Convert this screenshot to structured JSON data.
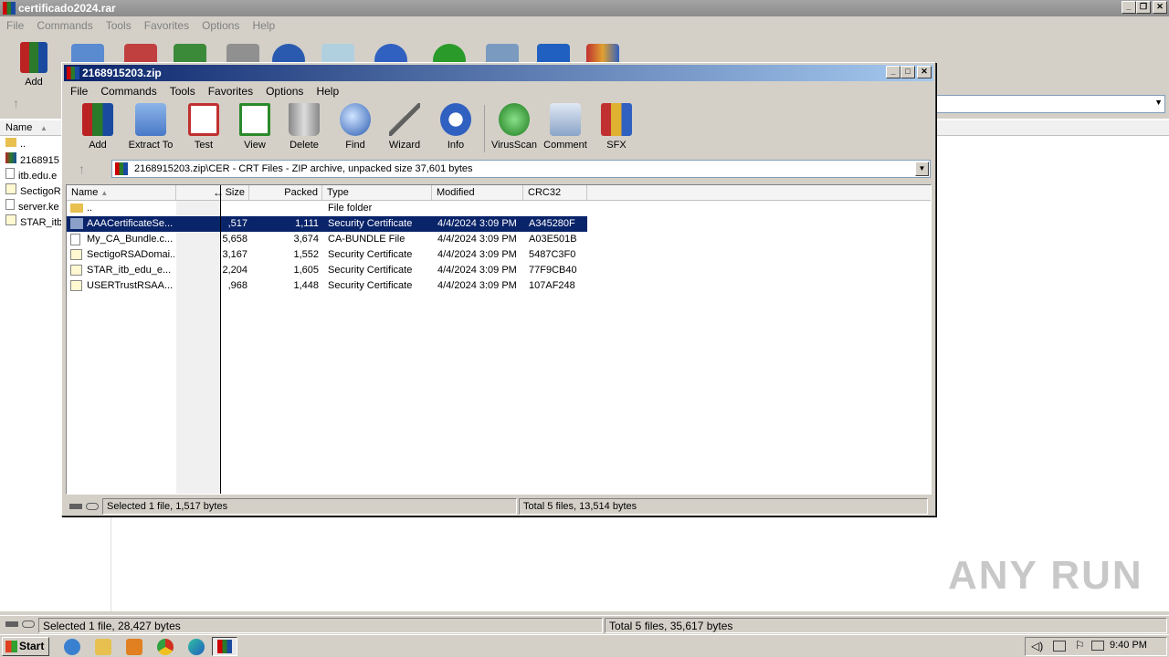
{
  "background_window": {
    "title": "certificado2024.rar",
    "menu": [
      "File",
      "Commands",
      "Tools",
      "Favorites",
      "Options",
      "Help"
    ],
    "toolbar_first_label": "Add",
    "column_name": "Name",
    "rows": [
      "..",
      "2168915",
      "itb.edu.e",
      "SectigoR",
      "server.ke",
      "STAR_itb"
    ],
    "status_left": "Selected 1 file, 28,427 bytes",
    "status_right": "Total 5 files, 35,617 bytes"
  },
  "front_window": {
    "title": "2168915203.zip",
    "menu": [
      "File",
      "Commands",
      "Tools",
      "Favorites",
      "Options",
      "Help"
    ],
    "toolbar": [
      "Add",
      "Extract To",
      "Test",
      "View",
      "Delete",
      "Find",
      "Wizard",
      "Info",
      "VirusScan",
      "Comment",
      "SFX"
    ],
    "path": "2168915203.zip\\CER - CRT Files - ZIP archive, unpacked size 37,601 bytes",
    "columns": [
      "Name",
      "Size",
      "Packed",
      "Type",
      "Modified",
      "CRC32"
    ],
    "rows": [
      {
        "name": "..",
        "size": "",
        "packed": "",
        "type": "File folder",
        "modified": "",
        "crc": ""
      },
      {
        "name": "AAACertificateSe...",
        "size": ",517",
        "packed": "1,111",
        "type": "Security Certificate",
        "modified": "4/4/2024 3:09 PM",
        "crc": "A345280F"
      },
      {
        "name": "My_CA_Bundle.c...",
        "size": "5,658",
        "packed": "3,674",
        "type": "CA-BUNDLE File",
        "modified": "4/4/2024 3:09 PM",
        "crc": "A03E501B"
      },
      {
        "name": "SectigoRSADomai...",
        "size": "3,167",
        "packed": "1,552",
        "type": "Security Certificate",
        "modified": "4/4/2024 3:09 PM",
        "crc": "5487C3F0"
      },
      {
        "name": "STAR_itb_edu_e...",
        "size": "2,204",
        "packed": "1,605",
        "type": "Security Certificate",
        "modified": "4/4/2024 3:09 PM",
        "crc": "77F9CB40"
      },
      {
        "name": "USERTrustRSAA...",
        "size": ",968",
        "packed": "1,448",
        "type": "Security Certificate",
        "modified": "4/4/2024 3:09 PM",
        "crc": "107AF248"
      }
    ],
    "status_left": "Selected 1 file, 1,517 bytes",
    "status_right": "Total 5 files, 13,514 bytes"
  },
  "taskbar": {
    "start": "Start",
    "clock": "9:40 PM"
  },
  "watermark": "ANY RUN",
  "colors": {
    "selection": "#0a246a",
    "title_active": "#0a246a",
    "title_inactive": "#8c8c8c"
  }
}
